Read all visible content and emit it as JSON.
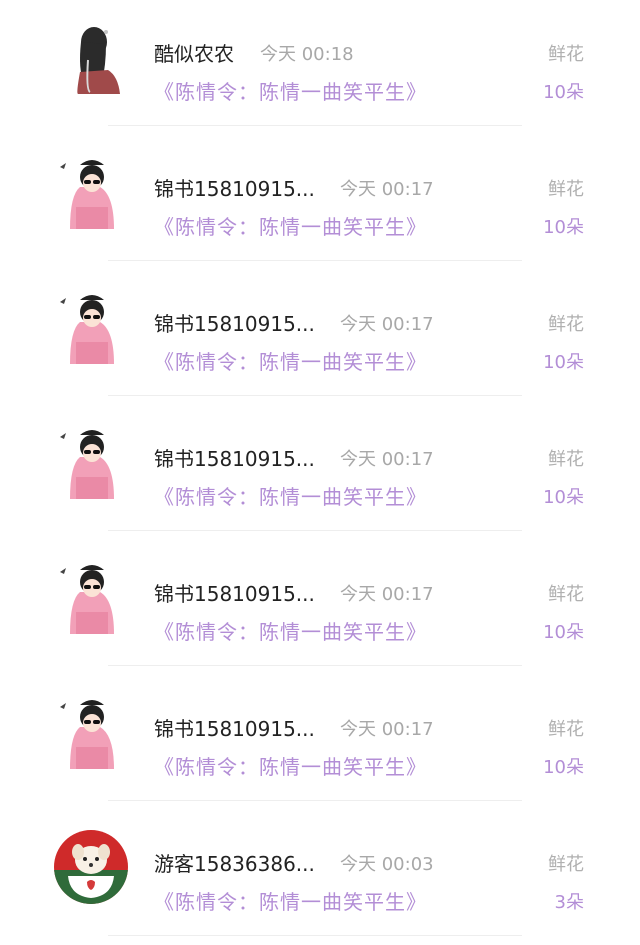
{
  "items": [
    {
      "name": "酷似农农",
      "time": "今天 00:18",
      "book": "《陈情令：陈情一曲笑平生》",
      "gift_label": "鲜花",
      "gift_count": "10朵",
      "avatar": "long-hair-girl-icon"
    },
    {
      "name": "锦书15810915...",
      "time": "今天 00:17",
      "book": "《陈情令：陈情一曲笑平生》",
      "gift_label": "鲜花",
      "gift_count": "10朵",
      "avatar": "cartoon-girl-icon"
    },
    {
      "name": "锦书15810915...",
      "time": "今天 00:17",
      "book": "《陈情令：陈情一曲笑平生》",
      "gift_label": "鲜花",
      "gift_count": "10朵",
      "avatar": "cartoon-girl-icon"
    },
    {
      "name": "锦书15810915...",
      "time": "今天 00:17",
      "book": "《陈情令：陈情一曲笑平生》",
      "gift_label": "鲜花",
      "gift_count": "10朵",
      "avatar": "cartoon-girl-icon"
    },
    {
      "name": "锦书15810915...",
      "time": "今天 00:17",
      "book": "《陈情令：陈情一曲笑平生》",
      "gift_label": "鲜花",
      "gift_count": "10朵",
      "avatar": "cartoon-girl-icon"
    },
    {
      "name": "锦书15810915...",
      "time": "今天 00:17",
      "book": "《陈情令：陈情一曲笑平生》",
      "gift_label": "鲜花",
      "gift_count": "10朵",
      "avatar": "cartoon-girl-icon"
    },
    {
      "name": "游客15836386...",
      "time": "今天 00:03",
      "book": "《陈情令：陈情一曲笑平生》",
      "gift_label": "鲜花",
      "gift_count": "3朵",
      "avatar": "puppy-in-teacup-icon"
    }
  ],
  "colors": {
    "accent": "#b38ed6",
    "name": "#222222",
    "muted": "#a8a8a8"
  }
}
